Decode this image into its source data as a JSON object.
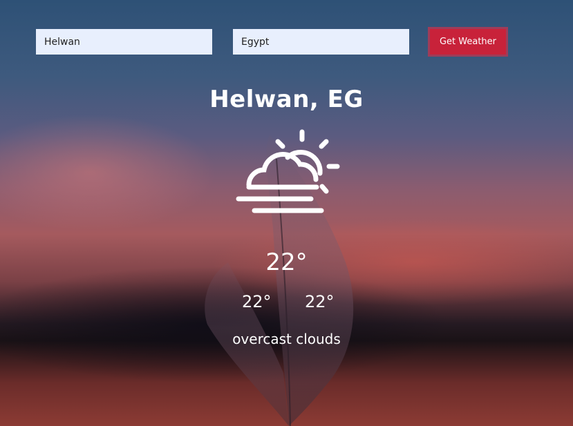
{
  "form": {
    "city_value": "Helwan",
    "country_value": "Egypt",
    "submit_label": "Get Weather"
  },
  "weather": {
    "location": "Helwan, EG",
    "icon": "fog-partly-cloudy-icon",
    "temperature": "22°",
    "temp_min": "22°",
    "temp_max": "22°",
    "description": "overcast clouds"
  },
  "colors": {
    "button": "#c8223a",
    "input_bg": "#e8effd",
    "text": "#ffffff"
  }
}
